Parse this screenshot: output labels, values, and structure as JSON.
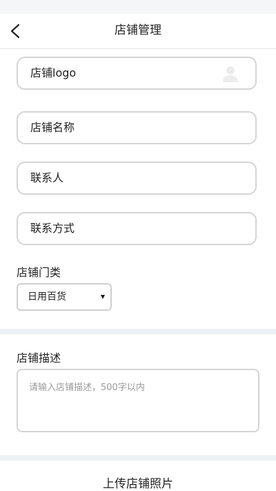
{
  "header": {
    "title": "店铺管理"
  },
  "form": {
    "logo_label": "店铺logo",
    "name_label": "店铺名称",
    "contact_label": "联系人",
    "phone_label": "联系方式"
  },
  "category": {
    "label": "店铺门类",
    "selected": "日用百货"
  },
  "description": {
    "label": "店铺描述",
    "placeholder": "请输入店铺描述，500字以内"
  },
  "upload": {
    "title": "上传店铺照片"
  },
  "icons": {
    "back": "chevron-left-icon",
    "avatar": "user-placeholder-icon",
    "caret": "caret-down-icon"
  },
  "colors": {
    "border": "#d4d4d4",
    "divider": "#eef1f4",
    "placeholder": "#9a9a9a"
  }
}
